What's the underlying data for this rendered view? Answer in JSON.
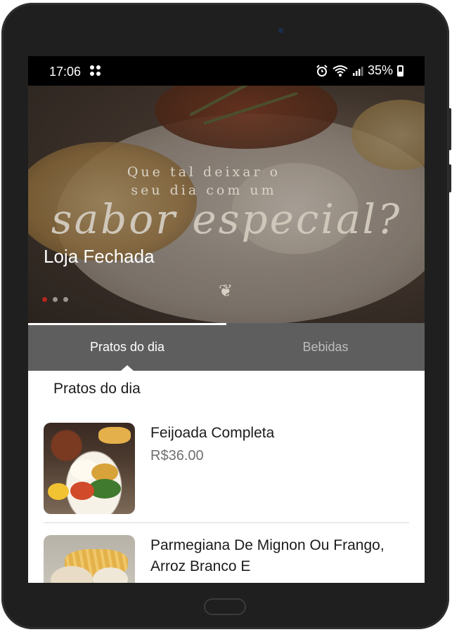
{
  "status_bar": {
    "time": "17:06",
    "battery": "35%"
  },
  "banner": {
    "line1": "Que tal deixar o",
    "line2": "seu dia com um",
    "script": "sabor especial?",
    "store_status": "Loja Fechada",
    "slide_count": 3,
    "active_slide": 1
  },
  "tabs": [
    {
      "label": "Pratos do dia",
      "active": true
    },
    {
      "label": "Bebidas",
      "active": false
    }
  ],
  "section": {
    "title": "Pratos do dia"
  },
  "menu_items": [
    {
      "name": "Feijoada Completa",
      "price": "R$36.00"
    },
    {
      "name": "Parmegiana De Mignon Ou Frango, Arroz Branco E",
      "price": ""
    }
  ],
  "colors": {
    "tab_bar": "#5e5e5e",
    "active_dot": "#b3261e",
    "price": "#707070"
  }
}
